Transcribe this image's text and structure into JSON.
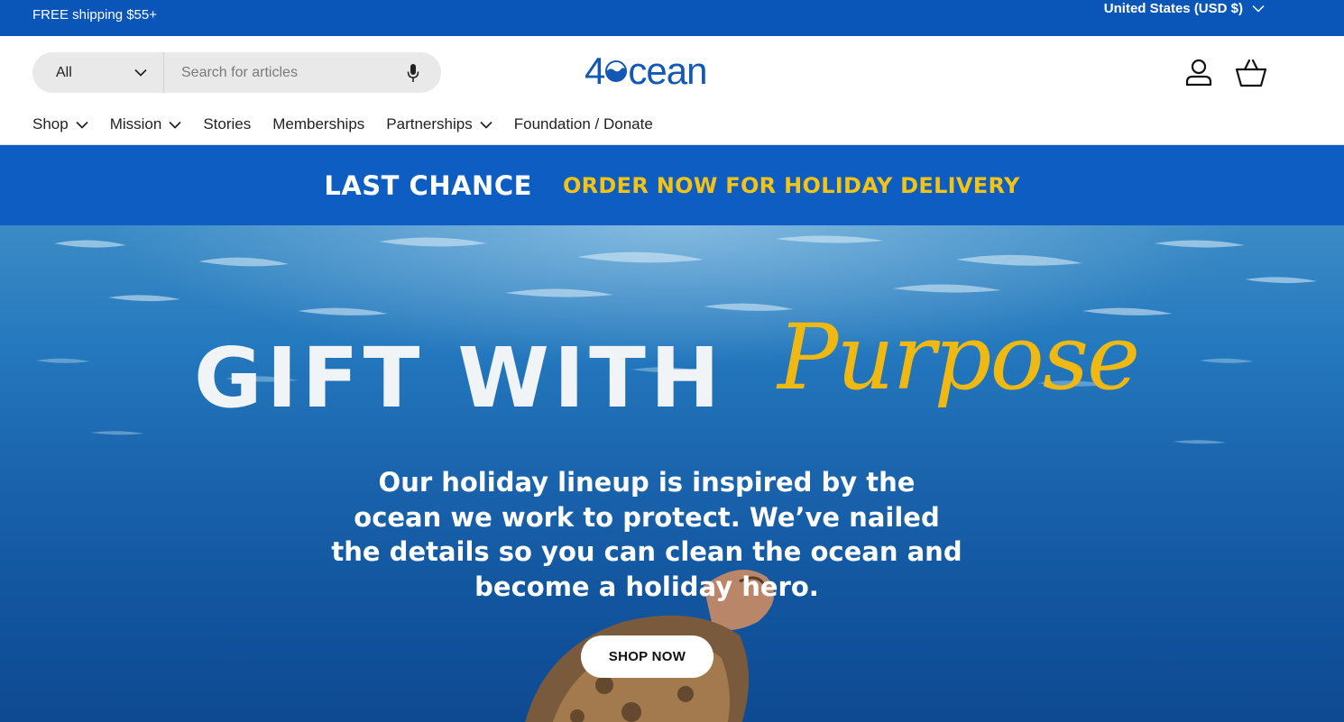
{
  "topbar": {
    "shipping_text": "FREE shipping $55+",
    "country_selector": "United States (USD $)"
  },
  "header": {
    "search": {
      "scope_value": "All",
      "placeholder": "Search for articles",
      "value": ""
    },
    "logo": {
      "prefix": "4",
      "suffix": "cean"
    },
    "icons": [
      "user-icon",
      "basket-icon",
      "microphone-icon",
      "chevron-down-icon"
    ],
    "nav": {
      "shop": "Shop",
      "mission": "Mission",
      "stories": "Stories",
      "memberships": "Memberships",
      "partnerships": "Partnerships",
      "foundation": "Foundation / Donate"
    }
  },
  "promo": {
    "label": "LAST CHANCE",
    "message": "ORDER NOW FOR HOLIDAY DELIVERY"
  },
  "hero": {
    "headline": "GIFT WITH",
    "headline_script": "Purpose",
    "body": "Our holiday lineup is inspired by the ocean we work to protect. We’ve nailed the details so you can clean the ocean and become a holiday hero.",
    "cta_label": "SHOP NOW"
  },
  "colors": {
    "brand_blue": "#0a56b8",
    "promo_yellow": "#f3c316",
    "script_yellow": "#f0b812"
  }
}
